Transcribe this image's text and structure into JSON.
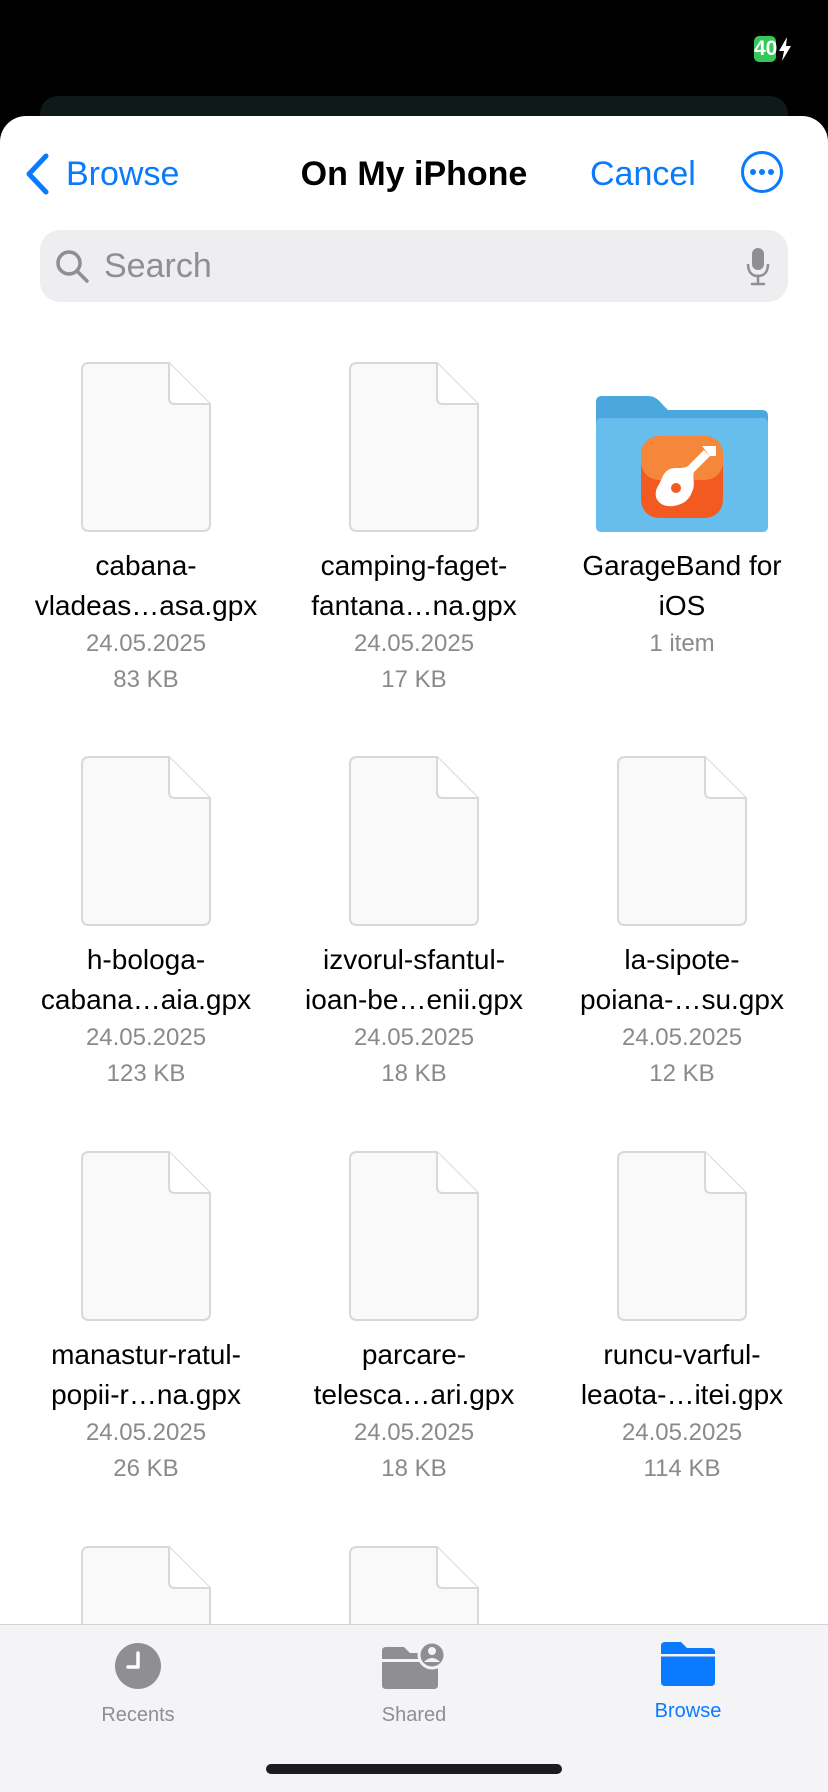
{
  "status_bar": {
    "battery_level": "40"
  },
  "nav": {
    "back_label": "Browse",
    "title": "On My iPhone",
    "cancel_label": "Cancel"
  },
  "search": {
    "placeholder": "Search"
  },
  "files": [
    {
      "name": "cabana-\nvladeas…asa.gpx",
      "date": "24.05.2025",
      "size": "83 KB",
      "kind": "document"
    },
    {
      "name": "camping-faget-\nfantana…na.gpx",
      "date": "24.05.2025",
      "size": "17 KB",
      "kind": "document"
    },
    {
      "name": "GarageBand for\niOS",
      "date": "1 item",
      "size": "",
      "kind": "folder"
    },
    {
      "name": "h-bologa-\ncabana…aia.gpx",
      "date": "24.05.2025",
      "size": "123 KB",
      "kind": "document"
    },
    {
      "name": "izvorul-sfantul-\nioan-be…enii.gpx",
      "date": "24.05.2025",
      "size": "18 KB",
      "kind": "document"
    },
    {
      "name": "la-sipote-\npoiana-…su.gpx",
      "date": "24.05.2025",
      "size": "12 KB",
      "kind": "document"
    },
    {
      "name": "manastur-ratul-\npopii-r…na.gpx",
      "date": "24.05.2025",
      "size": "26 KB",
      "kind": "document"
    },
    {
      "name": "parcare-\ntelesca…ari.gpx",
      "date": "24.05.2025",
      "size": "18 KB",
      "kind": "document"
    },
    {
      "name": "runcu-varful-\nleaota-…itei.gpx",
      "date": "24.05.2025",
      "size": "114 KB",
      "kind": "document"
    }
  ],
  "tabs": [
    {
      "label": "Recents",
      "icon": "clock-icon",
      "active": false
    },
    {
      "label": "Shared",
      "icon": "shared-folder-icon",
      "active": false
    },
    {
      "label": "Browse",
      "icon": "folder-icon",
      "active": true
    }
  ],
  "colors": {
    "accent": "#0a7aff",
    "battery": "#34c759"
  }
}
